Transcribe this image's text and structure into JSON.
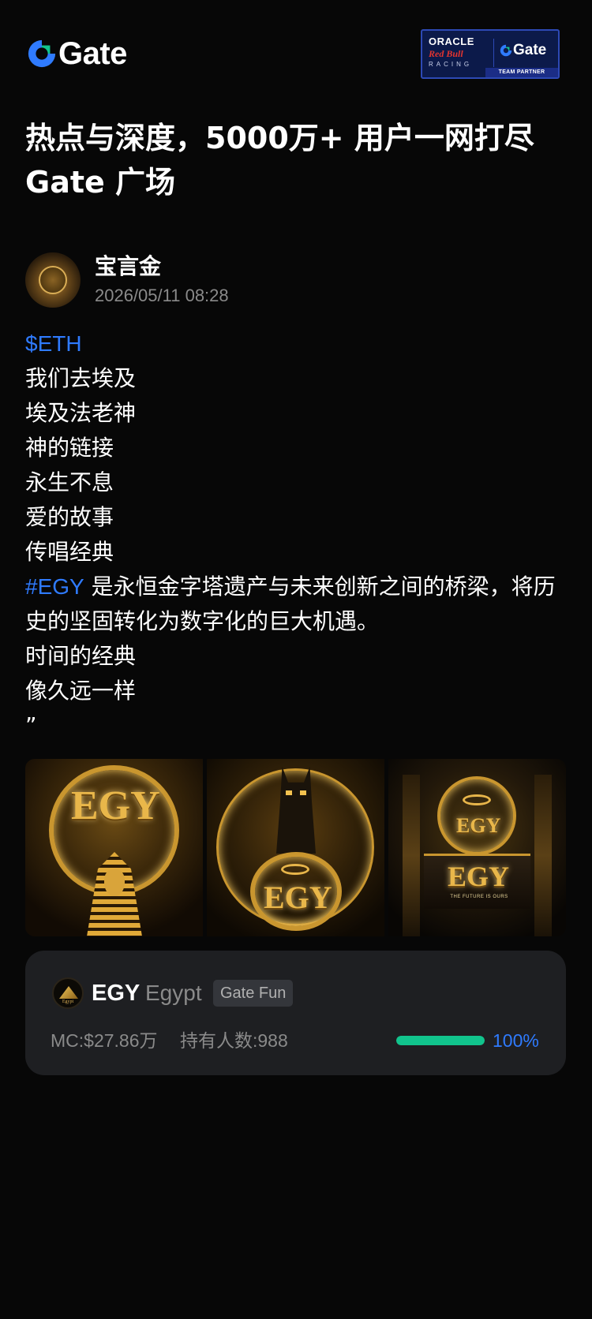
{
  "header": {
    "brand": "Gate",
    "partner": {
      "oracle": "ORACLE",
      "redbull": "Red Bull",
      "racing": "RACING",
      "gate": "Gate",
      "strip": "TEAM PARTNER"
    }
  },
  "headline": {
    "line1": "热点与深度，5000万+ 用户一网打尽",
    "line2": "Gate 广场"
  },
  "post": {
    "author": "宝言金",
    "time": "2026/05/11 08:28",
    "cashtag": "$ETH",
    "lines": [
      "我们去埃及",
      "埃及法老神",
      "神的链接",
      "永生不息",
      "爱的故事",
      "传唱经典"
    ],
    "hashtag": "#EGY",
    "hashtag_text": " 是永恒金字塔遗产与未来创新之间的桥梁，将历史的坚固转化为数字化的巨大机遇。",
    "lines2": [
      "时间的经典",
      "像久远一样",
      "”"
    ],
    "images": [
      {
        "label": "EGY"
      },
      {
        "label": "EGY"
      },
      {
        "label_top": "EGY",
        "label_bottom": "EGY",
        "tagline": "THE FUTURE IS OURS"
      }
    ]
  },
  "token_card": {
    "logo_text": "Egypt",
    "symbol": "EGY",
    "name": "Egypt",
    "badge": "Gate Fun",
    "market_cap": "MC:$27.86万",
    "holders": "持有人数:988",
    "progress": 1.0,
    "progress_label": "100%",
    "colors": {
      "progress": "#11c48d",
      "accent": "#2f7bff"
    }
  }
}
